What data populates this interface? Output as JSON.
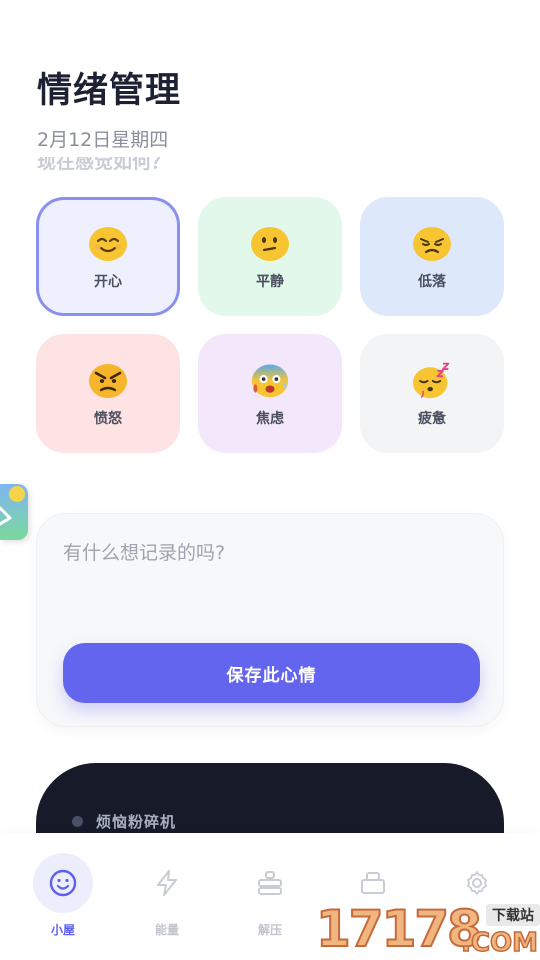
{
  "header": {
    "title": "情绪管理",
    "date": "2月12日星期四",
    "prompt_clipped": "现在感觉如何？"
  },
  "moods": [
    {
      "label": "开心",
      "icon": "smiling-face-icon",
      "bg": "#eef0fd",
      "selected": true
    },
    {
      "label": "平静",
      "icon": "neutral-face-icon",
      "bg": "#e2f8ea",
      "selected": false
    },
    {
      "label": "低落",
      "icon": "disappointed-face-icon",
      "bg": "#dde9fb",
      "selected": false
    },
    {
      "label": "愤怒",
      "icon": "angry-face-icon",
      "bg": "#fde3e3",
      "selected": false
    },
    {
      "label": "焦虑",
      "icon": "anxious-sweat-face-icon",
      "bg": "#f3e7fc",
      "selected": false
    },
    {
      "label": "疲惫",
      "icon": "sleepy-face-icon",
      "bg": "#f3f4f6",
      "selected": false
    }
  ],
  "note": {
    "placeholder": "有什么想记录的吗?",
    "save_label": "保存此心情"
  },
  "shredder": {
    "title": "烦恼粉碎机"
  },
  "tabs": [
    {
      "label": "小屋",
      "icon": "smile-face-tab-icon",
      "active": true
    },
    {
      "label": "能量",
      "icon": "lightning-icon",
      "active": false
    },
    {
      "label": "解压",
      "icon": "stack-icon",
      "active": false
    },
    {
      "label": "",
      "icon": "briefcase-icon",
      "active": false
    },
    {
      "label": "",
      "icon": "gear-icon",
      "active": false
    }
  ],
  "watermark": {
    "digits": "17178",
    "top_text": "下载站",
    "com_text": ".COM"
  },
  "colors": {
    "accent": "#6365ee",
    "selected_border": "#8a90ef",
    "dark_card": "#161a29"
  }
}
